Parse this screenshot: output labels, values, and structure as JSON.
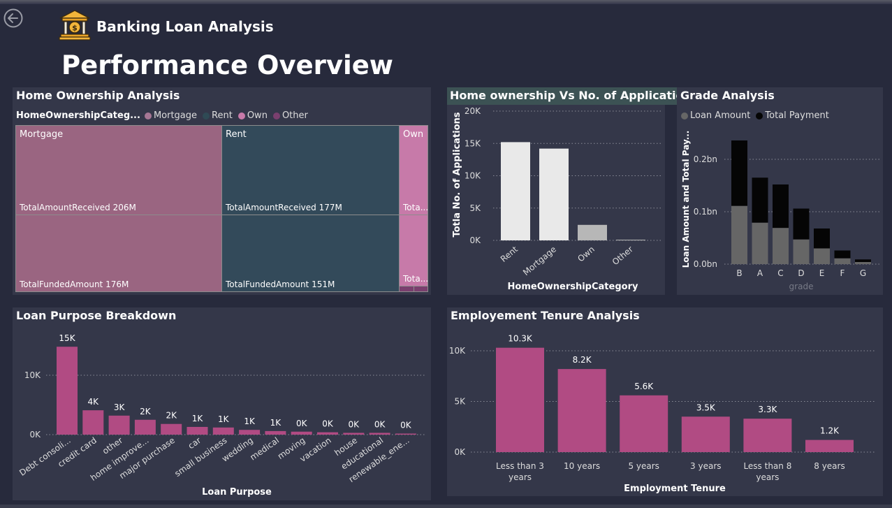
{
  "header": {
    "app_title": "Banking Loan Analysis",
    "page_title": "Performance Overview",
    "back_icon": "back-arrow-icon",
    "logo_icon": "bank-building-icon"
  },
  "colors": {
    "background": "#272a3c",
    "panel": "#343749",
    "mortgage": "#9a6581",
    "rent": "#334a5a",
    "own": "#c77aa9",
    "other": "#7a3f6e",
    "bar_pink": "#b14b83",
    "bar_light": "#e9e9e9",
    "bar_gray": "#b7b7b7",
    "grade_loan": "#666666",
    "grade_payment": "#050505"
  },
  "home_ownership": {
    "title": "Home Ownership Analysis",
    "legend_header": "HomeOwnershipCateg...",
    "legend": [
      {
        "label": "Mortgage",
        "color": "#a67795"
      },
      {
        "label": "Rent",
        "color": "#2f4a55"
      },
      {
        "label": "Own",
        "color": "#c77aa9"
      },
      {
        "label": "Other",
        "color": "#7a3f6e"
      }
    ],
    "mortgage": {
      "label": "Mortgage",
      "received": "TotalAmountReceived 206M",
      "funded": "TotalFundedAmount 176M"
    },
    "rent": {
      "label": "Rent",
      "received": "TotalAmountReceived 177M",
      "funded": "TotalFundedAmount 151M"
    },
    "own": {
      "label": "Own",
      "received": "Tota...",
      "funded": "Tota..."
    }
  },
  "applications": {
    "title": "Home ownership Vs No. of Applications",
    "chart_data": {
      "type": "bar",
      "categories": [
        "Rent",
        "Mortgage",
        "Own",
        "Other"
      ],
      "values": [
        15200,
        14200,
        2400,
        100
      ],
      "yticks": [
        "20K",
        "15K",
        "10K",
        "5K",
        "0K"
      ],
      "ylim": [
        0,
        20000
      ],
      "xlabel": "HomeOwnershipCategory",
      "ylabel": "Totla No. of Applications"
    }
  },
  "grade": {
    "title": "Grade Analysis",
    "legend": [
      {
        "label": "Loan Amount",
        "color": "#666666"
      },
      {
        "label": "Total Payment",
        "color": "#050505"
      }
    ],
    "chart_data": {
      "type": "bar",
      "categories": [
        "B",
        "A",
        "C",
        "D",
        "E",
        "F",
        "G"
      ],
      "series": [
        {
          "name": "Loan Amount",
          "values": [
            0.111,
            0.079,
            0.069,
            0.047,
            0.03,
            0.011,
            0.004
          ]
        },
        {
          "name": "Total Payment",
          "values": [
            0.236,
            0.165,
            0.152,
            0.106,
            0.068,
            0.026,
            0.009
          ]
        }
      ],
      "yticks": [
        "0.2bn",
        "0.1bn",
        "0.0bn"
      ],
      "ylim": [
        0,
        0.27
      ],
      "xlabel": "grade",
      "ylabel": "Loan Amount and Total Pay..."
    }
  },
  "purpose": {
    "title": "Loan Purpose Breakdown",
    "chart_data": {
      "type": "bar",
      "categories": [
        "Debt consoli...",
        "credit card",
        "other",
        "home improve...",
        "major purchase",
        "car",
        "small business",
        "wedding",
        "medical",
        "moving",
        "vacation",
        "house",
        "educational",
        "renewable_ene..."
      ],
      "values": [
        14.8,
        4.1,
        3.2,
        2.5,
        1.8,
        1.3,
        1.2,
        0.8,
        0.6,
        0.5,
        0.4,
        0.3,
        0.3,
        0.1
      ],
      "data_labels": [
        "15K",
        "4K",
        "3K",
        "2K",
        "2K",
        "1K",
        "1K",
        "1K",
        "1K",
        "0K",
        "0K",
        "0K",
        "0K",
        "0K"
      ],
      "yticks": [
        "10K",
        "0K"
      ],
      "ylim": [
        0,
        17.5
      ],
      "xlabel": "Loan Purpose"
    }
  },
  "tenure": {
    "title": "Employement Tenure Analysis",
    "chart_data": {
      "type": "bar",
      "categories": [
        "Less than 3 years",
        "10 years",
        "5 years",
        "3 years",
        "Less than 8 years",
        "8 years"
      ],
      "category_lines": [
        [
          "Less than 3",
          "years"
        ],
        [
          "10 years"
        ],
        [
          "5 years"
        ],
        [
          "3 years"
        ],
        [
          "Less than 8",
          "years"
        ],
        [
          "8 years"
        ]
      ],
      "values": [
        10.3,
        8.2,
        5.6,
        3.5,
        3.3,
        1.2
      ],
      "data_labels": [
        "10.3K",
        "8.2K",
        "5.6K",
        "3.5K",
        "3.3K",
        "1.2K"
      ],
      "yticks": [
        "10K",
        "5K",
        "0K"
      ],
      "ylim": [
        0,
        12
      ],
      "xlabel": "Employment Tenure"
    }
  }
}
